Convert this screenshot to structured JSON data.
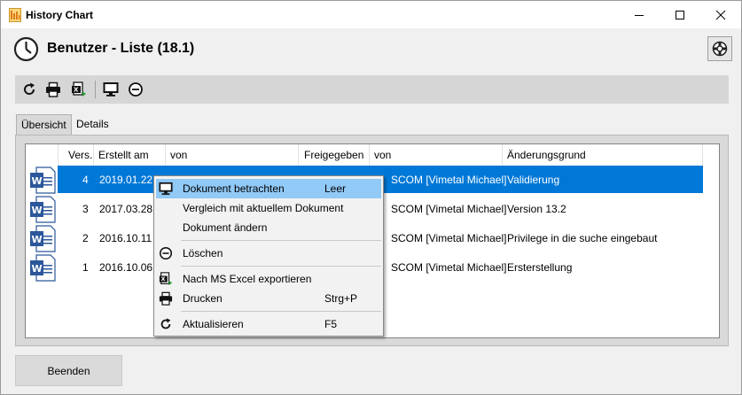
{
  "window": {
    "title": "History Chart"
  },
  "header": {
    "title": "Benutzer - Liste (18.1)"
  },
  "tabs": [
    {
      "label": "Übersicht"
    },
    {
      "label": "Details"
    }
  ],
  "table": {
    "headers": [
      "Vers.",
      "Erstellt am",
      "von",
      "Freigegeben",
      "von",
      "Änderungsgrund"
    ],
    "rows": [
      {
        "vers": "4",
        "erstellt": "2019.01.22",
        "von2": "SCOM [Vimetal Michael]",
        "grund": "Validierung"
      },
      {
        "vers": "3",
        "erstellt": "2017.03.28",
        "von2": "SCOM [Vimetal Michael]",
        "grund": "Version 13.2"
      },
      {
        "vers": "2",
        "erstellt": "2016.10.11",
        "von2": "SCOM [Vimetal Michael]",
        "grund": "Privilege in die suche eingebaut"
      },
      {
        "vers": "1",
        "erstellt": "2016.10.06",
        "von2": "SCOM [Vimetal Michael]",
        "grund": "Ersterstellung"
      }
    ]
  },
  "context_menu": {
    "items": [
      {
        "label": "Dokument betrachten",
        "shortcut": "Leer",
        "icon": "monitor-icon"
      },
      {
        "label": "Vergleich mit aktuellem Dokument",
        "shortcut": "",
        "icon": ""
      },
      {
        "label": "Dokument ändern",
        "shortcut": "",
        "icon": ""
      },
      {
        "label": "Löschen",
        "shortcut": "",
        "icon": "minus-circle-icon"
      },
      {
        "label": "Nach MS Excel exportieren",
        "shortcut": "",
        "icon": "excel-export-icon"
      },
      {
        "label": "Drucken",
        "shortcut": "Strg+P",
        "icon": "printer-icon"
      },
      {
        "label": "Aktualisieren",
        "shortcut": "F5",
        "icon": "refresh-icon"
      }
    ]
  },
  "footer": {
    "end_label": "Beenden"
  },
  "colors": {
    "selection": "#0078d7",
    "menu_highlight": "#91c9f7",
    "toolbar": "#d6d6d6"
  }
}
